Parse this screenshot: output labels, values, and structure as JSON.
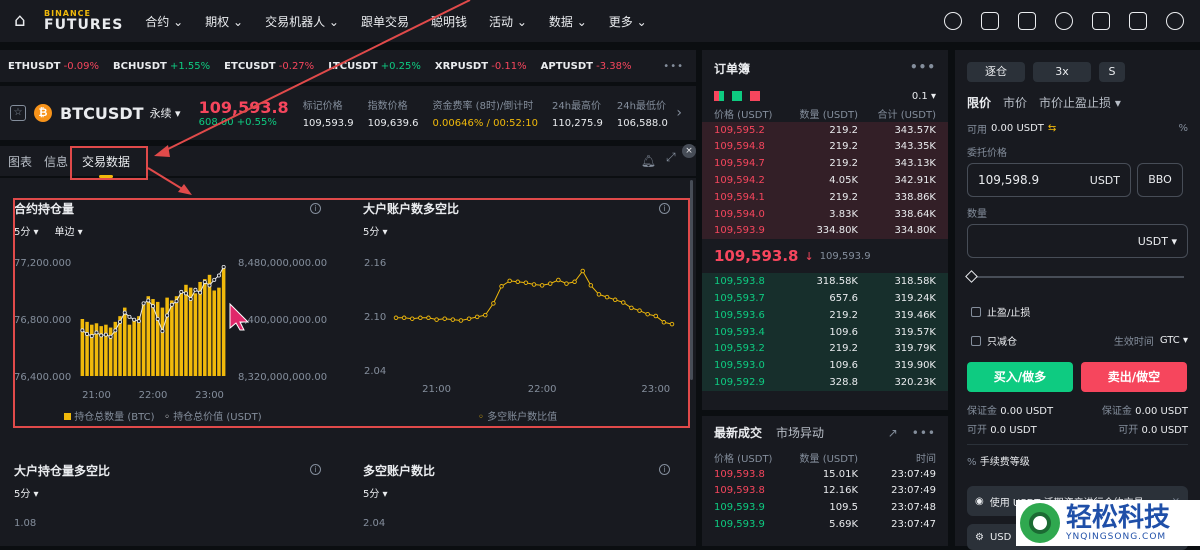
{
  "nav": {
    "logo_top": "BINANCE",
    "logo_bottom": "FUTURES",
    "menu": [
      "合约",
      "期权",
      "交易机器人",
      "跟单交易",
      "聪明钱",
      "活动",
      "数据",
      "更多"
    ]
  },
  "ticker": [
    {
      "symbol": "ETHUSDT",
      "change": "-0.09%",
      "dir": "neg"
    },
    {
      "symbol": "BCHUSDT",
      "change": "+1.55%",
      "dir": "pos"
    },
    {
      "symbol": "ETCUSDT",
      "change": "-0.27%",
      "dir": "neg"
    },
    {
      "symbol": "LTCUSDT",
      "change": "+0.25%",
      "dir": "pos"
    },
    {
      "symbol": "XRPUSDT",
      "change": "-0.11%",
      "dir": "neg"
    },
    {
      "symbol": "APTUSDT",
      "change": "-3.38%",
      "dir": "neg"
    }
  ],
  "symbol": {
    "name": "BTCUSDT",
    "type": "永续",
    "price": "109,593.8",
    "change": "608.00 +0.55%",
    "stats": [
      {
        "label": "标记价格",
        "value": "109,593.9"
      },
      {
        "label": "指数价格",
        "value": "109,639.6"
      },
      {
        "label": "资金费率 (8时)/倒计时",
        "value": "0.00646% / 00:52:10"
      },
      {
        "label": "24h最高价",
        "value": "110,275.9"
      },
      {
        "label": "24h最低价",
        "value": "106,588.0"
      }
    ]
  },
  "tabs": [
    "图表",
    "信息",
    "交易数据"
  ],
  "panels": {
    "oi": {
      "title": "合约持仓量",
      "interval": "5分",
      "mode": "单边",
      "legend1": "持仓总数量 (BTC)",
      "legend2": "持仓总价值 (USDT)"
    },
    "lsr": {
      "title": "大户账户数多空比",
      "interval": "5分",
      "legend": "多空账户数比值"
    },
    "tpr": {
      "title": "大户持仓量多空比",
      "interval": "5分",
      "y_top": "1.08"
    },
    "alsr": {
      "title": "多空账户数比",
      "interval": "5分",
      "y_top": "2.04"
    }
  },
  "chart_data": [
    {
      "type": "bar",
      "title": "合约持仓量",
      "x_ticks": [
        "21:00",
        "22:00",
        "23:00"
      ],
      "y_left_ticks": [
        "77,200.000",
        "76,800.000",
        "76,400.000"
      ],
      "y_right_ticks": [
        "8,480,000,000.00",
        "8,400,000,000.00",
        "8,320,000,000.00"
      ],
      "ylim": [
        76400,
        77200
      ],
      "series": [
        {
          "name": "持仓总数量 (BTC)",
          "values": [
            76800,
            76780,
            76760,
            76770,
            76750,
            76760,
            76740,
            76780,
            76820,
            76880,
            76760,
            76790,
            76820,
            76900,
            76960,
            76940,
            76920,
            76880,
            76950,
            76930,
            76960,
            76990,
            77040,
            77020,
            76980,
            77060,
            77080,
            77110,
            77000,
            77020,
            77160
          ]
        },
        {
          "name": "持仓总价值 (USDT)",
          "values": [
            8384000000,
            8379000000,
            8376000000,
            8381000000,
            8377000000,
            8378000000,
            8375000000,
            8384000000,
            8396000000,
            8409000000,
            8403000000,
            8399000000,
            8397000000,
            8422000000,
            8426000000,
            8418000000,
            8400000000,
            8383000000,
            8405000000,
            8420000000,
            8425000000,
            8438000000,
            8436000000,
            8428000000,
            8441000000,
            8437000000,
            8452000000,
            8447000000,
            8455000000,
            8461000000,
            8473000000
          ]
        }
      ]
    },
    {
      "type": "line",
      "title": "大户账户数多空比",
      "x_ticks": [
        "21:00",
        "22:00",
        "23:00"
      ],
      "y_ticks": [
        "2.16",
        "2.10",
        "2.04"
      ],
      "ylim": [
        2.04,
        2.16
      ],
      "series": [
        {
          "name": "多空账户数比值",
          "values": [
            2.098,
            2.098,
            2.097,
            2.098,
            2.098,
            2.096,
            2.097,
            2.096,
            2.095,
            2.097,
            2.099,
            2.101,
            2.114,
            2.133,
            2.139,
            2.138,
            2.137,
            2.135,
            2.134,
            2.136,
            2.14,
            2.136,
            2.138,
            2.15,
            2.134,
            2.124,
            2.121,
            2.118,
            2.115,
            2.109,
            2.106,
            2.102,
            2.1,
            2.093,
            2.091
          ]
        }
      ]
    }
  ],
  "orderbook": {
    "title": "订单簿",
    "precision": "0.1",
    "headers": [
      "价格 (USDT)",
      "数量 (USDT)",
      "合计 (USDT)"
    ],
    "asks": [
      [
        "109,595.2",
        "219.2",
        "343.57K"
      ],
      [
        "109,594.8",
        "219.2",
        "343.35K"
      ],
      [
        "109,594.7",
        "219.2",
        "343.13K"
      ],
      [
        "109,594.2",
        "4.05K",
        "342.91K"
      ],
      [
        "109,594.1",
        "219.2",
        "338.86K"
      ],
      [
        "109,594.0",
        "3.83K",
        "338.64K"
      ],
      [
        "109,593.9",
        "334.80K",
        "334.80K"
      ]
    ],
    "mid_price": "109,593.8",
    "mid_arrow": "↓",
    "mid_mark": "109,593.9",
    "bids": [
      [
        "109,593.8",
        "318.58K",
        "318.58K"
      ],
      [
        "109,593.7",
        "657.6",
        "319.24K"
      ],
      [
        "109,593.6",
        "219.2",
        "319.46K"
      ],
      [
        "109,593.4",
        "109.6",
        "319.57K"
      ],
      [
        "109,593.2",
        "219.2",
        "319.79K"
      ],
      [
        "109,593.0",
        "109.6",
        "319.90K"
      ],
      [
        "109,592.9",
        "328.8",
        "320.23K"
      ]
    ]
  },
  "trades": {
    "tab1": "最新成交",
    "tab2": "市场异动",
    "headers": [
      "价格 (USDT)",
      "数量 (USDT)",
      "时间"
    ],
    "rows": [
      {
        "p": "109,593.8",
        "q": "15.01K",
        "t": "23:07:49",
        "dir": "neg"
      },
      {
        "p": "109,593.8",
        "q": "12.16K",
        "t": "23:07:49",
        "dir": "neg"
      },
      {
        "p": "109,593.9",
        "q": "109.5",
        "t": "23:07:48",
        "dir": "pos"
      },
      {
        "p": "109,593.9",
        "q": "5.69K",
        "t": "23:07:47",
        "dir": "pos"
      }
    ]
  },
  "order": {
    "margin_mode": "逐仓",
    "leverage": "3x",
    "mode_s": "S",
    "types": [
      "限价",
      "市价",
      "市价止盈止损"
    ],
    "avail_label": "可用",
    "avail_value": "0.00 USDT",
    "price_label": "委托价格",
    "price_value": "109,598.9",
    "price_unit": "USDT",
    "bbo": "BBO",
    "qty_label": "数量",
    "qty_unit": "USDT",
    "tpsl": "止盈/止损",
    "reduce_only": "只减仓",
    "tif_label": "生效时间",
    "tif_value": "GTC",
    "buy": "买入/做多",
    "sell": "卖出/做空",
    "margin_label": "保证金",
    "margin_value": "0.00 USDT",
    "openable_label": "可开",
    "openable_value": "0.0 USDT",
    "fee_level": "手续费等级",
    "promo": "使用 USDT 活期资产进行合约交易",
    "promo2": "USD"
  },
  "watermark": {
    "cn": "轻松科技",
    "en": "YNQINGSONG.COM"
  }
}
